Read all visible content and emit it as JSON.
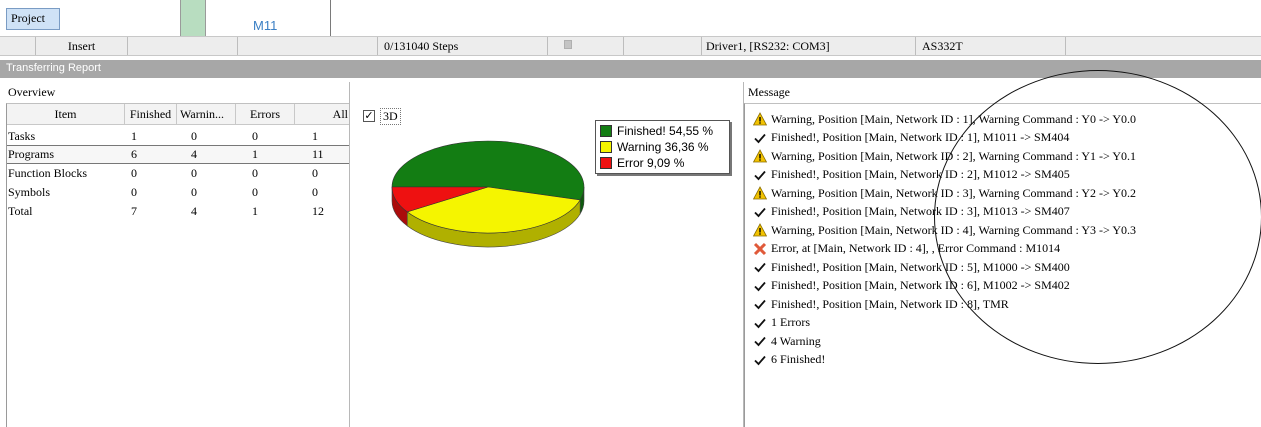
{
  "topbar": {
    "project_label": "Project",
    "tab_label": "M11"
  },
  "statusbar": {
    "insert_label": "Insert",
    "steps": "0/131040 Steps",
    "driver": "Driver1, [RS232: COM3]",
    "model": "AS332T"
  },
  "report": {
    "title": "Transferring Report"
  },
  "overview": {
    "title": "Overview",
    "columns": [
      "Item",
      "Finished",
      "Warnin...",
      "Errors",
      "All"
    ],
    "rows": [
      [
        "Tasks",
        "1",
        "0",
        "0",
        "1"
      ],
      [
        "Programs",
        "6",
        "4",
        "1",
        "11"
      ],
      [
        "Function Blocks",
        "0",
        "0",
        "0",
        "0"
      ],
      [
        "Symbols",
        "0",
        "0",
        "0",
        "0"
      ],
      [
        "Total",
        "7",
        "4",
        "1",
        "12"
      ]
    ],
    "selected_row": 1
  },
  "chart_controls": {
    "checkbox_label": "3D",
    "checked": true
  },
  "chart_data": {
    "type": "pie",
    "three_d": true,
    "slices": [
      {
        "label": "Finished!",
        "percent": 54.55,
        "color": "#137d13"
      },
      {
        "label": "Warning",
        "percent": 36.36,
        "color": "#f5f500"
      },
      {
        "label": "Error",
        "percent": 9.09,
        "color": "#ee1111"
      }
    ],
    "legend": [
      "Finished! 54,55 %",
      "Warning 36,36 %",
      "Error 9,09 %"
    ],
    "legend_position": "right"
  },
  "messages": {
    "title": "Message",
    "items": [
      {
        "icon": "warning-icon",
        "text": "Warning, Position [Main, Network ID : 1], Warning Command : Y0 -> Y0.0"
      },
      {
        "icon": "check-icon",
        "text": "Finished!, Position [Main, Network ID : 1], M1011 -> SM404"
      },
      {
        "icon": "warning-icon",
        "text": "Warning, Position [Main, Network ID : 2], Warning Command : Y1 -> Y0.1"
      },
      {
        "icon": "check-icon",
        "text": "Finished!, Position [Main, Network ID : 2], M1012 -> SM405"
      },
      {
        "icon": "warning-icon",
        "text": "Warning, Position [Main, Network ID : 3], Warning Command : Y2 -> Y0.2"
      },
      {
        "icon": "check-icon",
        "text": "Finished!, Position [Main, Network ID : 3], M1013 -> SM407"
      },
      {
        "icon": "warning-icon",
        "text": "Warning, Position [Main, Network ID : 4], Warning Command : Y3 -> Y0.3"
      },
      {
        "icon": "error-icon",
        "text": "Error, at [Main, Network ID : 4], , Error Command : M1014"
      },
      {
        "icon": "check-icon",
        "text": "Finished!, Position [Main, Network ID : 5], M1000 -> SM400"
      },
      {
        "icon": "check-icon",
        "text": "Finished!, Position [Main, Network ID : 6], M1002 -> SM402"
      },
      {
        "icon": "check-icon",
        "text": "Finished!, Position [Main, Network ID : 8], TMR"
      },
      {
        "icon": "check-icon",
        "text": "1 Errors"
      },
      {
        "icon": "check-icon",
        "text": "4 Warning"
      },
      {
        "icon": "check-icon",
        "text": "6 Finished!"
      }
    ]
  },
  "colors": {
    "report_header": "#a7a7a7",
    "accent_tab": "#3a7fc4",
    "finished": "#137d13",
    "warning": "#f5f500",
    "error": "#ee1111"
  }
}
